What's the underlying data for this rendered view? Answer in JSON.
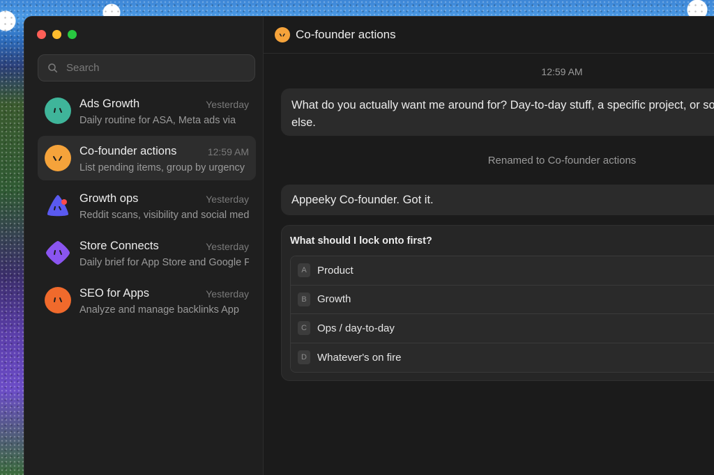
{
  "window": {
    "title": "Co-founder actions"
  },
  "search": {
    "placeholder": "Search"
  },
  "chats": [
    {
      "name": "Ads Growth",
      "time": "Yesterday",
      "preview": "Daily routine for ASA, Meta ads via",
      "avatar_color": "#3fb59a",
      "icon": "face-icon"
    },
    {
      "name": "Co-founder actions",
      "time": "12:59 AM",
      "preview": "List pending items, group by urgency",
      "avatar_color": "#f5a33b",
      "icon": "face-icon"
    },
    {
      "name": "Growth ops",
      "time": "Yesterday",
      "preview": "Reddit scans, visibility and social media",
      "avatar_color": "#5a5af0",
      "icon": "triangle-face-icon"
    },
    {
      "name": "Store Connects",
      "time": "Yesterday",
      "preview": "Daily brief for App Store and Google Play",
      "avatar_color": "#8a55f0",
      "icon": "diamond-face-icon"
    },
    {
      "name": "SEO for Apps",
      "time": "Yesterday",
      "preview": "Analyze and manage backlinks App",
      "avatar_color": "#f06a2c",
      "icon": "face-icon"
    }
  ],
  "conversation": {
    "timestamp": "12:59 AM",
    "user_message_1": "What do you actually want me around for? Day-to-day stuff, a specific project, or something else.",
    "system_note": "Renamed to Co-founder actions",
    "user_message_2": "Appeeky Co-founder. Got it.",
    "question": {
      "title": "What should I lock onto first?",
      "options": [
        {
          "key": "A",
          "label": "Product"
        },
        {
          "key": "B",
          "label": "Growth"
        },
        {
          "key": "C",
          "label": "Ops / day-to-day"
        },
        {
          "key": "D",
          "label": "Whatever's on fire"
        }
      ]
    }
  }
}
